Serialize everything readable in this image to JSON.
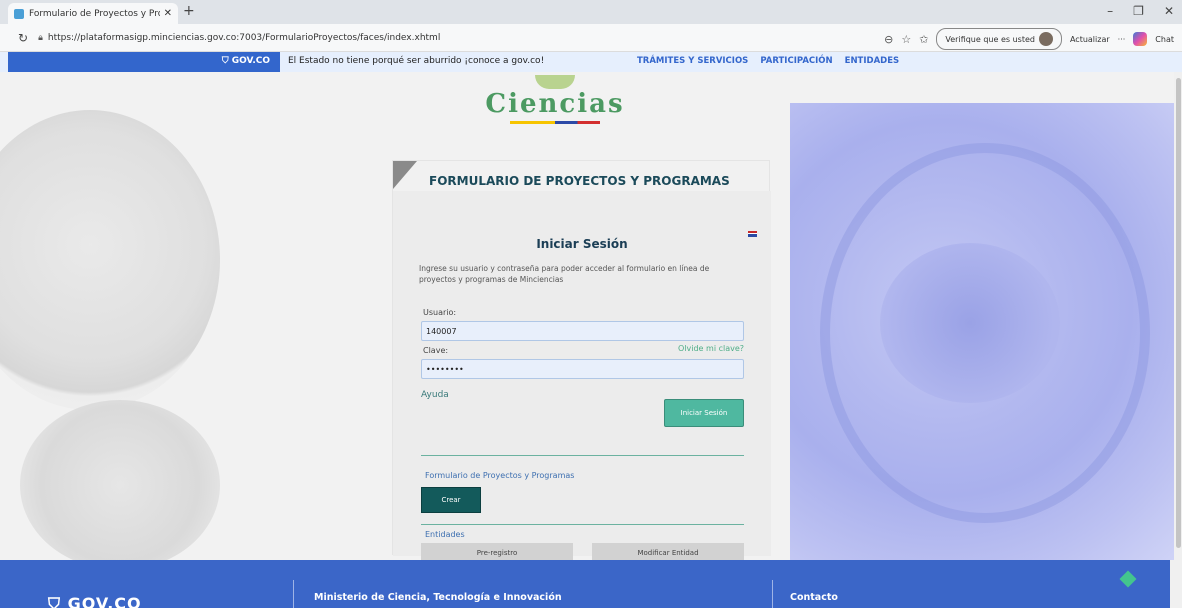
{
  "browser": {
    "tab_title": "Formulario de Proyectos y Progra",
    "tab_close": "✕",
    "new_tab": "+",
    "url": "https://plataformasigp.minciencias.gov.co:7003/FormularioProyectos/faces/index.xhtml",
    "verify_label": "Verifique que es usted",
    "update_label": "Actualizar",
    "more": "···",
    "chat_label": "Chat",
    "win_min": "–",
    "win_max": "❐",
    "win_close": "✕"
  },
  "govbar": {
    "logo": "GOV.CO",
    "message": "El Estado no tiene porqué ser aburrido ¡conoce a gov.co!",
    "nav": [
      "TRÁMITES Y SERVICIOS",
      "PARTICIPACIÓN",
      "ENTIDADES"
    ]
  },
  "logo": {
    "text": "Ciencias"
  },
  "panel": {
    "title": "FORMULARIO DE PROYECTOS Y PROGRAMAS",
    "login_title": "Iniciar Sesión",
    "intro": "Ingrese su usuario y contraseña para poder acceder al formulario en línea de proyectos y programas de Minciencias",
    "user_label": "Usuario:",
    "user_value": "140007",
    "password_label": "Clave:",
    "password_value": "••••••••",
    "forgot": "Olvide mi clave?",
    "help": "Ayuda",
    "login_button": "Iniciar Sesión",
    "section_form": "Formulario de Proyectos y Programas",
    "create_button": "Crear",
    "section_entities": "Entidades",
    "preregistro_button": "Pre-registro",
    "modify_button": "Modificar Entidad"
  },
  "footer": {
    "logo": "GOV.CO",
    "ministry": "Ministerio de Ciencia, Tecnología e Innovación",
    "contact": "Contacto"
  },
  "colors": {
    "gov_blue": "#3366cc",
    "accent_teal": "#4fb8a0",
    "dark_teal": "#135a5b",
    "footer_blue": "#3b66c8"
  }
}
